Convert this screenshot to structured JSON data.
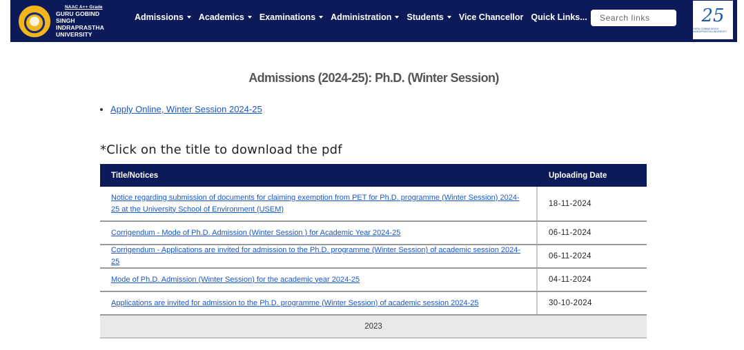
{
  "header": {
    "grade": "NAAC A++ Grade",
    "university_lines": [
      "GURU GOBIND",
      "SINGH",
      "INDRAPRASTHA",
      "UNIVERSITY"
    ],
    "nav": [
      {
        "label": "Admissions",
        "dropdown": true
      },
      {
        "label": "Academics",
        "dropdown": true
      },
      {
        "label": "Examinations",
        "dropdown": true
      },
      {
        "label": "Administration",
        "dropdown": true
      },
      {
        "label": "Students",
        "dropdown": true
      },
      {
        "label": "Vice Chancellor",
        "dropdown": false
      },
      {
        "label": "Quick Links...",
        "dropdown": true
      }
    ],
    "search_placeholder": "Search links",
    "badge_number": "25",
    "badge_text": "GURU GOBIND SINGH INDRAPRASTHA UNIVERSITY"
  },
  "main": {
    "title": "Admissions (2024-25): Ph.D. (Winter Session)",
    "apply_link": "Apply Online, Winter Session 2024-25",
    "hint": "*Click on the title to download the pdf",
    "table": {
      "headers": [
        "Title/Notices",
        "Uploading Date"
      ],
      "rows": [
        {
          "title": "Notice regarding submission of documents for claiming exemption from PET for Ph.D. programme (Winter Session) 2024-25 at the University School of Environment (USEM)",
          "date": "18-11-2024"
        },
        {
          "title": "Corrigendum - Mode of Ph.D. Admission (Winter Session ) for Academic Year 2024-25",
          "date": "06-11-2024"
        },
        {
          "title": "Corrigendum - Applications are invited for admission to the Ph.D. programme (Winter Session) of academic session 2024-25",
          "date": "06-11-2024"
        },
        {
          "title": "Mode of Ph.D. Admission (Winter Session) for the academic year 2024-25",
          "date": "04-11-2024"
        },
        {
          "title": "Applications are invited for admission to the Ph.D. programme (Winter Session) of academic session 2024-25",
          "date": "30-10-2024"
        }
      ],
      "year_group": "2023"
    }
  },
  "colors": {
    "navy": "#0c1a5a",
    "link": "#1a57c9",
    "seal_gold": "#f3b51c"
  }
}
